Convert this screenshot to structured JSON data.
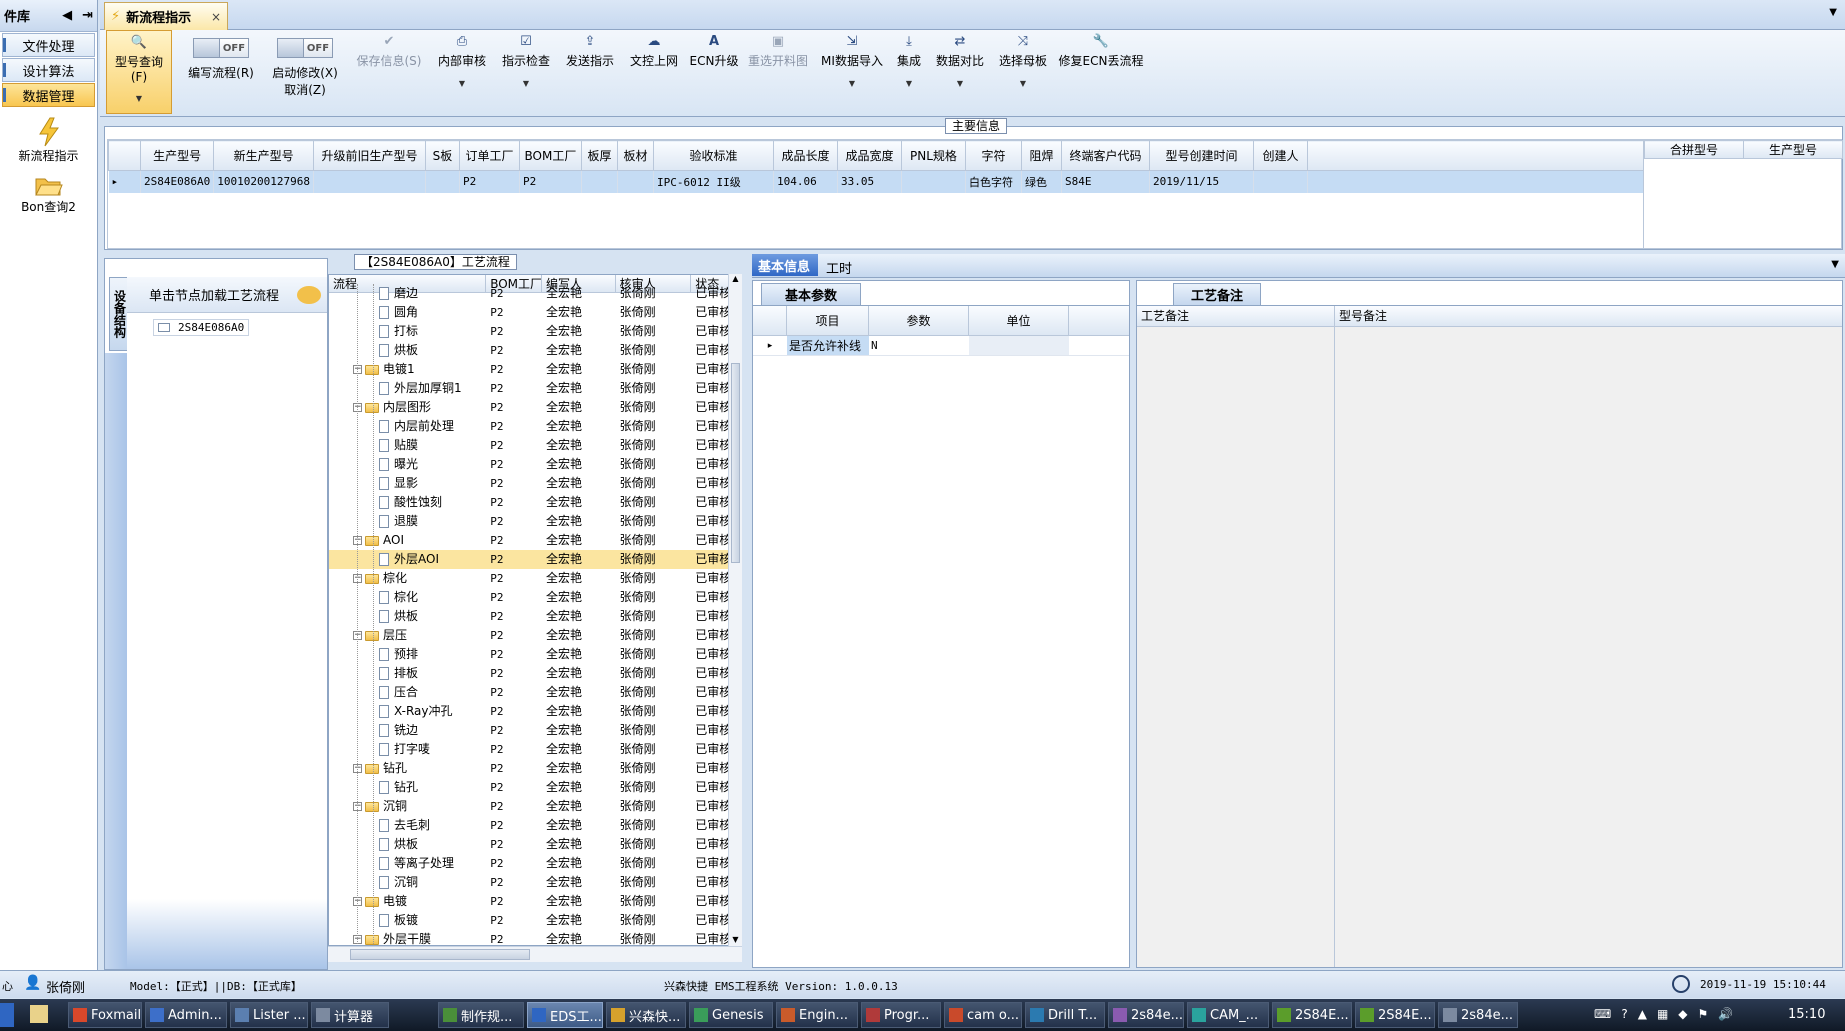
{
  "leftnav": {
    "header": "件库",
    "items": [
      {
        "label": "文件处理",
        "active": false
      },
      {
        "label": "设计算法",
        "active": false
      },
      {
        "label": "数据管理",
        "active": true
      }
    ],
    "icons": [
      {
        "label": "新流程指示",
        "icon": "lightning-icon"
      },
      {
        "label": "Bon查询2",
        "icon": "folder-open-icon"
      }
    ]
  },
  "tabs": {
    "active": "新流程指示",
    "close": "×"
  },
  "toolbar": {
    "query": "型号查询(F)",
    "edit_flow": "编写流程(R)",
    "edit_off": "OFF",
    "start_modify": "启动修改(X)",
    "start_off": "OFF",
    "cancel": "取消(Z)",
    "save_info": "保存信息(S)",
    "internal_review": "内部审核",
    "instruct_check": "指示检查",
    "send_instruct": "发送指示",
    "doc_upload": "文控上网",
    "ecn_upgrade": "ECN升级",
    "choose_material": "重选开料图",
    "mi_import": "MI数据导入",
    "integrate": "集成",
    "data_compare": "数据对比",
    "choose_mother": "选择母板",
    "fix_ecn": "修复ECN丢流程"
  },
  "main_info": {
    "label": "主要信息",
    "columns": [
      "生产型号",
      "新生产型号",
      "升级前旧生产型号",
      "S板",
      "订单工厂",
      "BOM工厂",
      "板厚",
      "板材",
      "验收标准",
      "成品长度",
      "成品宽度",
      "PNL规格",
      "字符",
      "阻焊",
      "终端客户代码",
      "型号创建时间",
      "创建人"
    ],
    "rows": [
      [
        "2S84E086A0",
        "10010200127968",
        "",
        "",
        "P2",
        "P2",
        "",
        "",
        "IPC-6012 II级",
        "104.06",
        "33.05",
        "",
        "白色字符",
        "绿色",
        "S84E",
        "2019/11/15",
        ""
      ]
    ],
    "side_columns": [
      "合拼型号",
      "生产型号"
    ]
  },
  "left_panel": {
    "vertical_tab": "设备结构",
    "hint": "单击节点加载工艺流程",
    "root_node": "2S84E086A0"
  },
  "process": {
    "label": "【2S84E086A0】工艺流程",
    "columns": [
      "流程",
      "BOM工厂",
      "编写人",
      "核审人",
      "状态"
    ],
    "rows": [
      {
        "name": "磨边",
        "lvl": 2,
        "folder": false,
        "factory": "P2",
        "writer": "全宏艳",
        "reviewer": "张倚刚",
        "status": "已审核"
      },
      {
        "name": "圆角",
        "lvl": 2,
        "folder": false,
        "factory": "P2",
        "writer": "全宏艳",
        "reviewer": "张倚刚",
        "status": "已审核"
      },
      {
        "name": "打标",
        "lvl": 2,
        "folder": false,
        "factory": "P2",
        "writer": "全宏艳",
        "reviewer": "张倚刚",
        "status": "已审核"
      },
      {
        "name": "烘板",
        "lvl": 2,
        "folder": false,
        "factory": "P2",
        "writer": "全宏艳",
        "reviewer": "张倚刚",
        "status": "已审核"
      },
      {
        "name": "电镀1",
        "lvl": 1,
        "folder": true,
        "factory": "P2",
        "writer": "全宏艳",
        "reviewer": "张倚刚",
        "status": "已审核"
      },
      {
        "name": "外层加厚铜1",
        "lvl": 2,
        "folder": false,
        "factory": "P2",
        "writer": "全宏艳",
        "reviewer": "张倚刚",
        "status": "已审核"
      },
      {
        "name": "内层图形",
        "lvl": 1,
        "folder": true,
        "factory": "P2",
        "writer": "全宏艳",
        "reviewer": "张倚刚",
        "status": "已审核"
      },
      {
        "name": "内层前处理",
        "lvl": 2,
        "folder": false,
        "factory": "P2",
        "writer": "全宏艳",
        "reviewer": "张倚刚",
        "status": "已审核"
      },
      {
        "name": "贴膜",
        "lvl": 2,
        "folder": false,
        "factory": "P2",
        "writer": "全宏艳",
        "reviewer": "张倚刚",
        "status": "已审核"
      },
      {
        "name": "曝光",
        "lvl": 2,
        "folder": false,
        "factory": "P2",
        "writer": "全宏艳",
        "reviewer": "张倚刚",
        "status": "已审核"
      },
      {
        "name": "显影",
        "lvl": 2,
        "folder": false,
        "factory": "P2",
        "writer": "全宏艳",
        "reviewer": "张倚刚",
        "status": "已审核"
      },
      {
        "name": "酸性蚀刻",
        "lvl": 2,
        "folder": false,
        "factory": "P2",
        "writer": "全宏艳",
        "reviewer": "张倚刚",
        "status": "已审核"
      },
      {
        "name": "退膜",
        "lvl": 2,
        "folder": false,
        "factory": "P2",
        "writer": "全宏艳",
        "reviewer": "张倚刚",
        "status": "已审核"
      },
      {
        "name": "AOI",
        "lvl": 1,
        "folder": true,
        "factory": "P2",
        "writer": "全宏艳",
        "reviewer": "张倚刚",
        "status": "已审核"
      },
      {
        "name": "外层AOI",
        "lvl": 2,
        "folder": false,
        "factory": "P2",
        "writer": "全宏艳",
        "reviewer": "张倚刚",
        "status": "已审核",
        "hl": true
      },
      {
        "name": "棕化",
        "lvl": 1,
        "folder": true,
        "factory": "P2",
        "writer": "全宏艳",
        "reviewer": "张倚刚",
        "status": "已审核"
      },
      {
        "name": "棕化",
        "lvl": 2,
        "folder": false,
        "factory": "P2",
        "writer": "全宏艳",
        "reviewer": "张倚刚",
        "status": "已审核"
      },
      {
        "name": "烘板",
        "lvl": 2,
        "folder": false,
        "factory": "P2",
        "writer": "全宏艳",
        "reviewer": "张倚刚",
        "status": "已审核"
      },
      {
        "name": "层压",
        "lvl": 1,
        "folder": true,
        "factory": "P2",
        "writer": "全宏艳",
        "reviewer": "张倚刚",
        "status": "已审核"
      },
      {
        "name": "预排",
        "lvl": 2,
        "folder": false,
        "factory": "P2",
        "writer": "全宏艳",
        "reviewer": "张倚刚",
        "status": "已审核"
      },
      {
        "name": "排板",
        "lvl": 2,
        "folder": false,
        "factory": "P2",
        "writer": "全宏艳",
        "reviewer": "张倚刚",
        "status": "已审核"
      },
      {
        "name": "压合",
        "lvl": 2,
        "folder": false,
        "factory": "P2",
        "writer": "全宏艳",
        "reviewer": "张倚刚",
        "status": "已审核"
      },
      {
        "name": "X-Ray冲孔",
        "lvl": 2,
        "folder": false,
        "factory": "P2",
        "writer": "全宏艳",
        "reviewer": "张倚刚",
        "status": "已审核"
      },
      {
        "name": "铣边",
        "lvl": 2,
        "folder": false,
        "factory": "P2",
        "writer": "全宏艳",
        "reviewer": "张倚刚",
        "status": "已审核"
      },
      {
        "name": "打字唛",
        "lvl": 2,
        "folder": false,
        "factory": "P2",
        "writer": "全宏艳",
        "reviewer": "张倚刚",
        "status": "已审核"
      },
      {
        "name": "钻孔",
        "lvl": 1,
        "folder": true,
        "factory": "P2",
        "writer": "全宏艳",
        "reviewer": "张倚刚",
        "status": "已审核"
      },
      {
        "name": "钻孔",
        "lvl": 2,
        "folder": false,
        "factory": "P2",
        "writer": "全宏艳",
        "reviewer": "张倚刚",
        "status": "已审核"
      },
      {
        "name": "沉铜",
        "lvl": 1,
        "folder": true,
        "factory": "P2",
        "writer": "全宏艳",
        "reviewer": "张倚刚",
        "status": "已审核"
      },
      {
        "name": "去毛刺",
        "lvl": 2,
        "folder": false,
        "factory": "P2",
        "writer": "全宏艳",
        "reviewer": "张倚刚",
        "status": "已审核"
      },
      {
        "name": "烘板",
        "lvl": 2,
        "folder": false,
        "factory": "P2",
        "writer": "全宏艳",
        "reviewer": "张倚刚",
        "status": "已审核"
      },
      {
        "name": "等离子处理",
        "lvl": 2,
        "folder": false,
        "factory": "P2",
        "writer": "全宏艳",
        "reviewer": "张倚刚",
        "status": "已审核"
      },
      {
        "name": "沉铜",
        "lvl": 2,
        "folder": false,
        "factory": "P2",
        "writer": "全宏艳",
        "reviewer": "张倚刚",
        "status": "已审核"
      },
      {
        "name": "电镀",
        "lvl": 1,
        "folder": true,
        "factory": "P2",
        "writer": "全宏艳",
        "reviewer": "张倚刚",
        "status": "已审核"
      },
      {
        "name": "板镀",
        "lvl": 2,
        "folder": false,
        "factory": "P2",
        "writer": "全宏艳",
        "reviewer": "张倚刚",
        "status": "已审核"
      },
      {
        "name": "外层干膜",
        "lvl": 1,
        "folder": true,
        "factory": "P2",
        "writer": "全宏艳",
        "reviewer": "张倚刚",
        "status": "已审核"
      }
    ]
  },
  "basic": {
    "tab_basic": "基本信息",
    "tab_hours": "工时",
    "subtab": "基本参数",
    "columns": [
      "项目",
      "参数",
      "单位"
    ],
    "row": {
      "item": "是否允许补线",
      "param": "N",
      "unit": ""
    }
  },
  "remarks": {
    "subtab": "工艺备注",
    "col_process": "工艺备注",
    "col_model": "型号备注"
  },
  "status": {
    "left": "心",
    "user": "张倚刚",
    "model": "Model:【正式】||DB:【正式库】",
    "app": "兴森快捷 EMS工程系统 Version: 1.0.0.13",
    "datetime": "2019-11-19 15:10:44"
  },
  "taskbar": {
    "items": [
      "Foxmail",
      "Admin...",
      "Lister ...",
      "计算器",
      "制作规...",
      "EDS工...",
      "兴森快...",
      "Genesis",
      "Engin...",
      "Progr...",
      "cam o...",
      "Drill T...",
      "2s84e...",
      "CAM_...",
      "2S84E...",
      "2S84E...",
      "2s84e..."
    ],
    "clock": "15:10"
  }
}
